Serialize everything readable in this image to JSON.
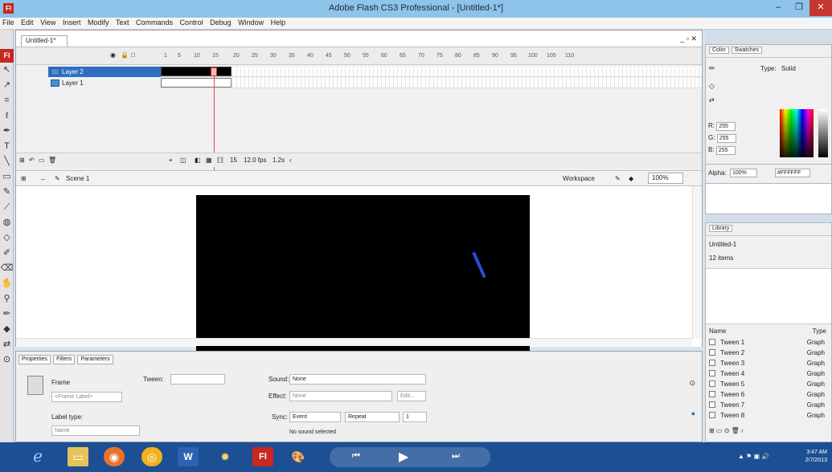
{
  "window": {
    "app_icon": "Fl",
    "title": "Adobe Flash CS3 Professional - [Untitled-1*]",
    "min": "–",
    "max": "❐",
    "close": "✕"
  },
  "menu": [
    "File",
    "Edit",
    "View",
    "Insert",
    "Modify",
    "Text",
    "Commands",
    "Control",
    "Debug",
    "Window",
    "Help"
  ],
  "document": {
    "tab": "Untitled-1*",
    "controls": "_ ▫ ✕"
  },
  "timeline": {
    "ruler": [
      "1",
      "5",
      "10",
      "15",
      "20",
      "25",
      "30",
      "35",
      "40",
      "45",
      "50",
      "55",
      "60",
      "65",
      "70",
      "75",
      "80",
      "85",
      "90",
      "95",
      "100",
      "105",
      "110"
    ],
    "layers": [
      {
        "name": "Layer 2",
        "selected": true
      },
      {
        "name": "Layer 1",
        "selected": false
      }
    ],
    "current_frame": "15",
    "fps": "12.0 fps",
    "time": "1.2s"
  },
  "editbar": {
    "scene": "Scene 1",
    "workspace": "Workspace",
    "zoom": "100%"
  },
  "properties": {
    "tabs": [
      "Properties",
      "Filters",
      "Parameters"
    ],
    "frame_label": "Frame",
    "frame_placeholder": "<Frame Label>",
    "tween_label": "Tween:",
    "label_type_label": "Label type:",
    "label_type_value": "Name",
    "sound_label": "Sound:",
    "sound_value": "None",
    "effect_label": "Effect:",
    "effect_value": "None",
    "edit_button": "Edit...",
    "sync_label": "Sync:",
    "sync_value": "Event",
    "repeat_value": "Repeat",
    "repeat_count": "1",
    "sound_status": "No sound selected"
  },
  "color_panel": {
    "tabs": [
      "Color",
      "Swatches"
    ],
    "type_label": "Type:",
    "type_value": "Solid",
    "r_label": "R:",
    "r_value": "255",
    "g_label": "G:",
    "g_value": "255",
    "b_label": "B:",
    "b_value": "255",
    "alpha_label": "Alpha:",
    "alpha_value": "100%",
    "hex_value": "#FFFFFF"
  },
  "library": {
    "tab": "Library",
    "document": "Untitled-1",
    "count": "12 items",
    "col_name": "Name",
    "col_type": "Type",
    "items": [
      {
        "name": "Tween 1",
        "type": "Graph"
      },
      {
        "name": "Tween 2",
        "type": "Graph"
      },
      {
        "name": "Tween 3",
        "type": "Graph"
      },
      {
        "name": "Tween 4",
        "type": "Graph"
      },
      {
        "name": "Tween 5",
        "type": "Graph"
      },
      {
        "name": "Tween 6",
        "type": "Graph"
      },
      {
        "name": "Tween 7",
        "type": "Graph"
      },
      {
        "name": "Tween 8",
        "type": "Graph"
      }
    ]
  },
  "taskbar": {
    "time": "3:47 AM",
    "date": "2/7/2013",
    "word_label": "W",
    "flash_label": "Fl"
  },
  "colors": {
    "title_bar": "#8ec3ea",
    "taskbar": "#1c4f93",
    "stage": "#000000",
    "stroke": "#2a4bd3",
    "playhead": "#e14a4a"
  }
}
